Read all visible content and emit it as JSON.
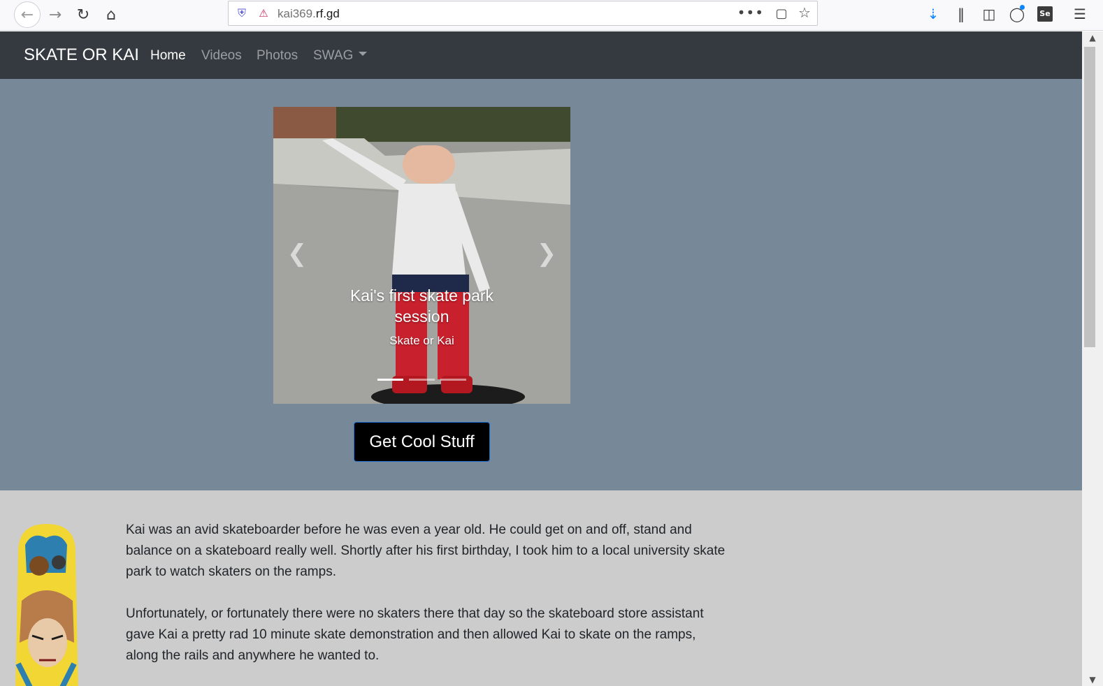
{
  "browser": {
    "url_prefix": "kai369.",
    "url_host": "rf.gd",
    "more_label": "•••"
  },
  "navbar": {
    "brand": "SKATE OR KAI",
    "links": [
      {
        "label": "Home",
        "active": true
      },
      {
        "label": "Videos"
      },
      {
        "label": "Photos"
      },
      {
        "label": "SWAG"
      }
    ]
  },
  "carousel": {
    "caption_title": "Kai's first skate park session",
    "caption_subtitle": "Skate or Kai",
    "slide_count": 3,
    "active_slide": 1
  },
  "cta": {
    "label": "Get Cool Stuff"
  },
  "about": {
    "paragraphs": [
      "Kai was an avid skateboarder before he was even a year old. He could get on and off, stand and balance on a skateboard really well. Shortly after his first birthday, I took him to a local university skate park to watch skaters on the ramps.",
      "Unfortunately, or fortunately there were no skaters there that day so the skateboard store assistant gave Kai a pretty rad 10 minute skate demonstration and then allowed Kai to skate on the ramps, along the rails and anywhere he wanted to."
    ]
  },
  "colors": {
    "navbar_bg": "#343a40",
    "hero_bg": "#778899",
    "about_bg": "#cccccc",
    "cta_bg": "#000000"
  }
}
